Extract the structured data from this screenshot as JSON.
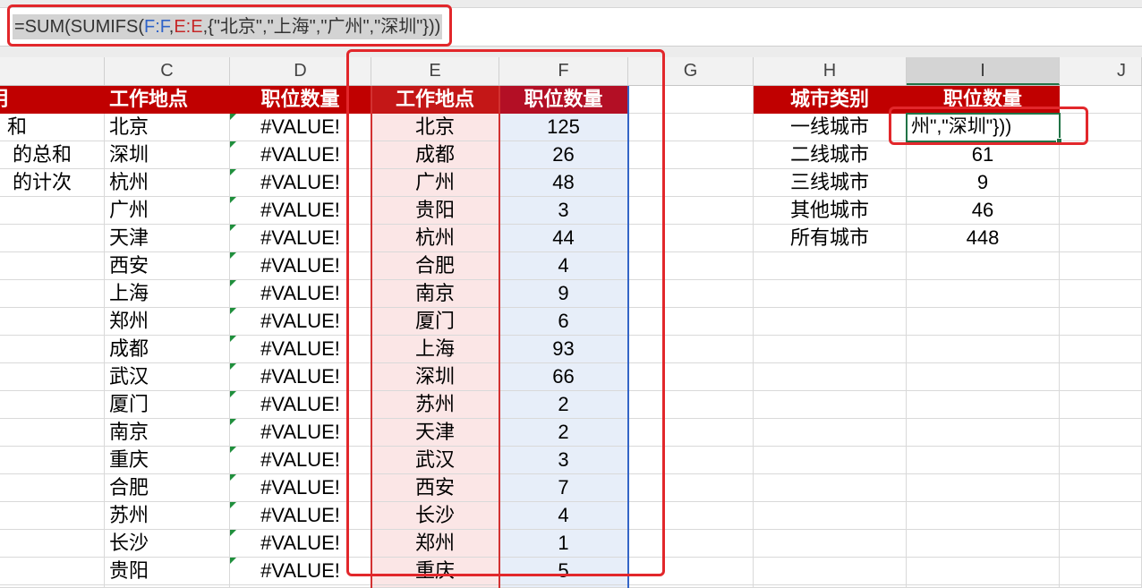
{
  "formula_bar": {
    "parts": [
      {
        "text": "=SUM(SUMIFS(",
        "color": "#333333"
      },
      {
        "text": "F:F",
        "color": "#2f63c8"
      },
      {
        "text": ",",
        "color": "#333333"
      },
      {
        "text": "E:E",
        "color": "#c62828"
      },
      {
        "text": ",{\"北京\",\"上海\",\"广州\",\"深圳\"}))",
        "color": "#333333"
      }
    ]
  },
  "column_headers": [
    "C",
    "D",
    "E",
    "F",
    "G",
    "H",
    "I",
    "J"
  ],
  "selected_column": "I",
  "sheet": {
    "B": {
      "header": "明",
      "rows": [
        "和",
        "的总和",
        "的计次"
      ]
    },
    "C": {
      "header": "工作地点",
      "rows": [
        "北京",
        "深圳",
        "杭州",
        "广州",
        "天津",
        "西安",
        "上海",
        "郑州",
        "成都",
        "武汉",
        "厦门",
        "南京",
        "重庆",
        "合肥",
        "苏州",
        "长沙",
        "贵阳"
      ]
    },
    "D": {
      "header": "职位数量",
      "rows": [
        "#VALUE!",
        "#VALUE!",
        "#VALUE!",
        "#VALUE!",
        "#VALUE!",
        "#VALUE!",
        "#VALUE!",
        "#VALUE!",
        "#VALUE!",
        "#VALUE!",
        "#VALUE!",
        "#VALUE!",
        "#VALUE!",
        "#VALUE!",
        "#VALUE!",
        "#VALUE!",
        "#VALUE!"
      ]
    },
    "E": {
      "header": "工作地点",
      "rows": [
        "北京",
        "成都",
        "广州",
        "贵阳",
        "杭州",
        "合肥",
        "南京",
        "厦门",
        "上海",
        "深圳",
        "苏州",
        "天津",
        "武汉",
        "西安",
        "长沙",
        "郑州",
        "重庆"
      ]
    },
    "F": {
      "header": "职位数量",
      "rows": [
        "125",
        "26",
        "48",
        "3",
        "44",
        "4",
        "9",
        "6",
        "93",
        "66",
        "2",
        "2",
        "3",
        "7",
        "4",
        "1",
        "5"
      ]
    },
    "H": {
      "header": "城市类别",
      "rows": [
        "一线城市",
        "二线城市",
        "三线城市",
        "其他城市",
        "所有城市"
      ]
    },
    "I": {
      "header": "职位数量",
      "rows": [
        "州\",\"深圳\"}))",
        "61",
        "9",
        "46",
        "448"
      ]
    }
  },
  "colors": {
    "header_fill": "#c00000",
    "header_fill_e": "#c41717",
    "header_fill_f": "#b30f25",
    "ref_e_border": "#d23131",
    "ref_f_border": "#3465c7",
    "ref_e_fill": "#fbe6e6",
    "ref_f_fill": "#e7eef9",
    "active_cell": "#217346",
    "error_indicator": "#1f8f3c",
    "annotation": "#e2272b",
    "selection_highlight": "#d3d3d3"
  }
}
